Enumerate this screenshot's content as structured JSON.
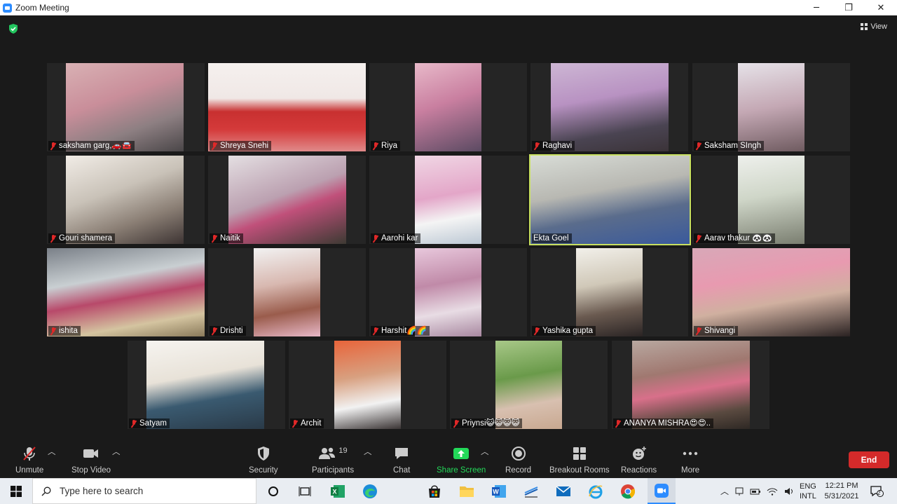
{
  "window": {
    "title": "Zoom Meeting",
    "minimize": "─",
    "restore": "❐",
    "close": "✕"
  },
  "view_label": "View",
  "participants_tiles": [
    {
      "name": "saksham garg,🚗🚘"
    },
    {
      "name": "Shreya Snehi"
    },
    {
      "name": "Riya"
    },
    {
      "name": "Raghavi"
    },
    {
      "name": "Saksham SIngh"
    },
    {
      "name": "Gouri shamera"
    },
    {
      "name": "Naitik"
    },
    {
      "name": "Aarohi kar"
    },
    {
      "name": "Ekta Goel"
    },
    {
      "name": "Aarav thakur 🐼🐼"
    },
    {
      "name": "ishita"
    },
    {
      "name": "Drishti"
    },
    {
      "name": "Harshit🌈🌈"
    },
    {
      "name": "Yashika gupta"
    },
    {
      "name": "Shivangi"
    },
    {
      "name": "Satyam"
    },
    {
      "name": "Archit"
    },
    {
      "name": "Priynsi😺😺😺😺"
    },
    {
      "name": "ANANYA MISHRA😍😍.."
    }
  ],
  "toolbar": {
    "unmute": "Unmute",
    "stop_video": "Stop Video",
    "security": "Security",
    "participants": "Participants",
    "participants_count": "19",
    "chat": "Chat",
    "share_screen": "Share Screen",
    "record": "Record",
    "breakout_rooms": "Breakout Rooms",
    "reactions": "Reactions",
    "more": "More",
    "end": "End"
  },
  "colors": {
    "share_green": "#23d959",
    "end_red": "#d42a2a",
    "active_outline": "#c8e060"
  },
  "taskbar": {
    "search_placeholder": "Type here to search",
    "lang_top": "ENG",
    "lang_bottom": "INTL",
    "time": "12:21 PM",
    "date": "5/31/2021",
    "notification_count": "2"
  }
}
